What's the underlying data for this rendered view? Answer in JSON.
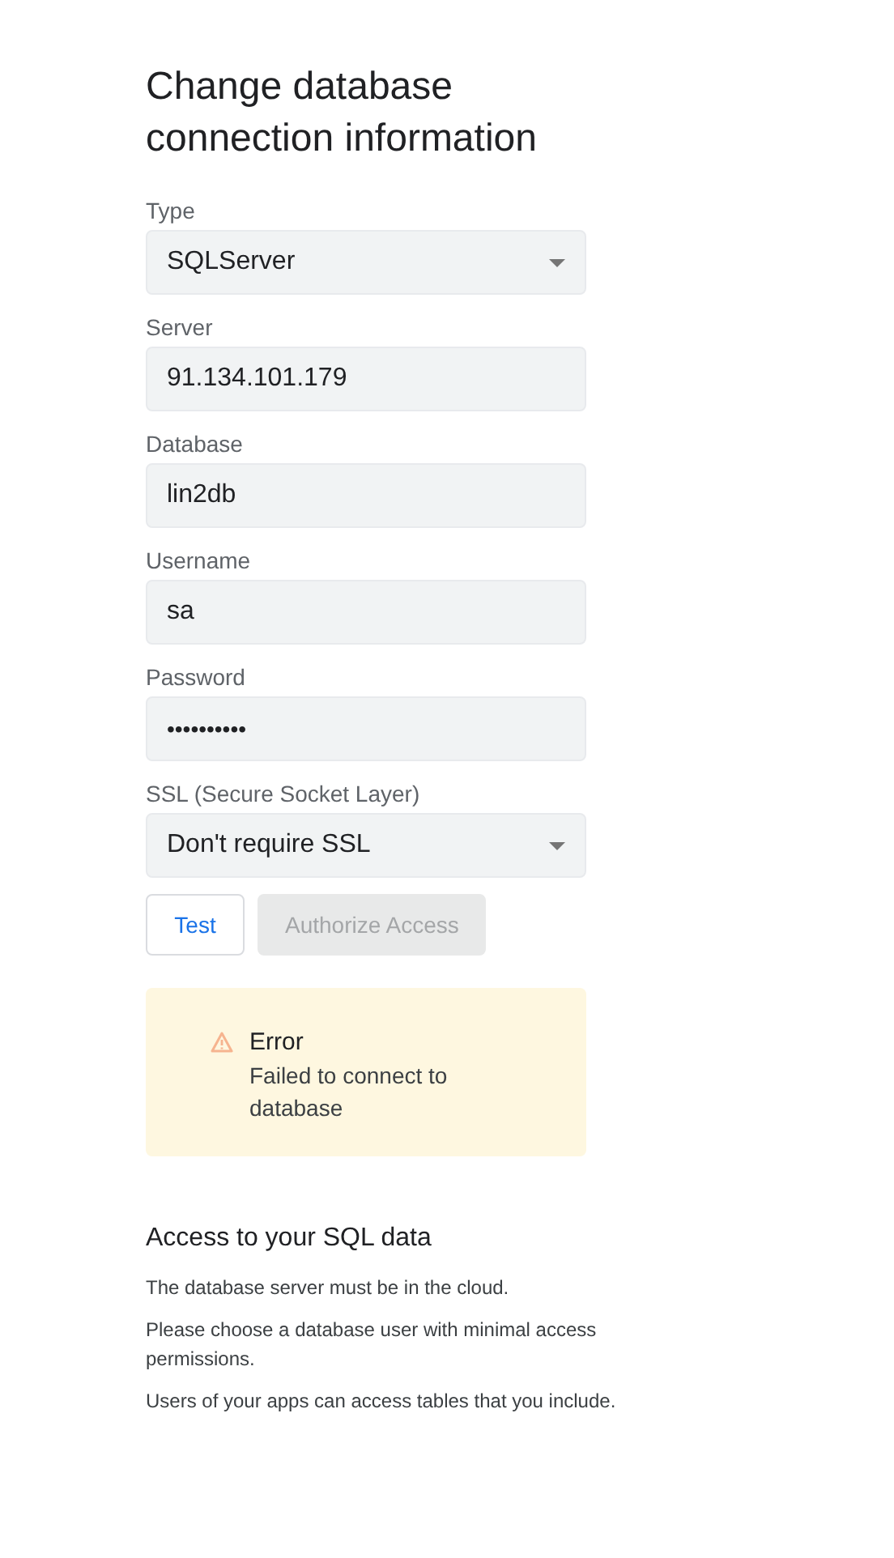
{
  "title": "Change database connection information",
  "fields": [
    {
      "label": "Type",
      "kind": "select",
      "value": "SQLServer"
    },
    {
      "label": "Server",
      "kind": "text",
      "value": "91.134.101.179"
    },
    {
      "label": "Database",
      "kind": "text",
      "value": "lin2db"
    },
    {
      "label": "Username",
      "kind": "text",
      "value": "sa"
    },
    {
      "label": "Password",
      "kind": "password",
      "value": "••••••••••"
    },
    {
      "label": "SSL (Secure Socket Layer)",
      "kind": "select",
      "value": "Don't require SSL"
    }
  ],
  "buttons": [
    {
      "label": "Test",
      "disabled": false
    },
    {
      "label": "Authorize Access",
      "disabled": true
    }
  ],
  "alert": {
    "title": "Error",
    "message": "Failed to connect to database"
  },
  "info": {
    "heading": "Access to your SQL data",
    "paragraphs": [
      "The database server must be in the cloud.",
      "Please choose a database user with minimal access permissions.",
      "Users of your apps can access tables that you include."
    ]
  }
}
